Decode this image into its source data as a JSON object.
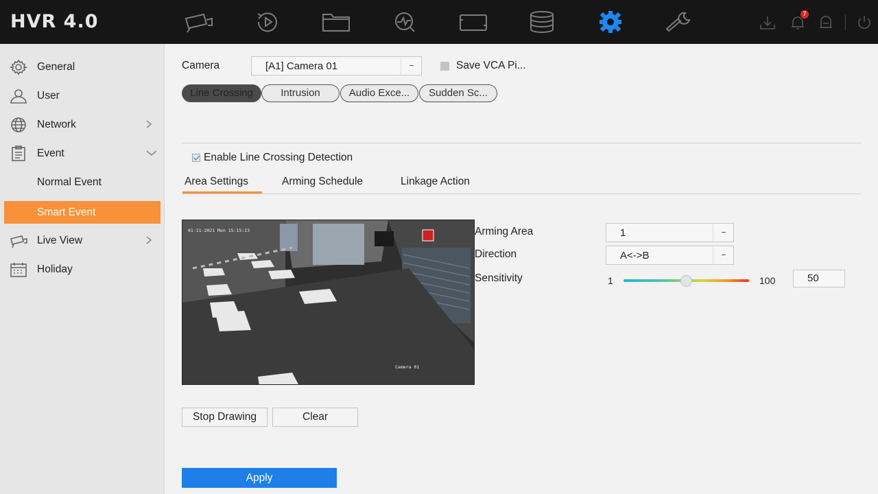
{
  "app": {
    "title": "HVR 4.0"
  },
  "topnav": {
    "items": [
      {
        "name": "live-view",
        "icon": "camera-icon"
      },
      {
        "name": "playback",
        "icon": "playback-icon"
      },
      {
        "name": "file-management",
        "icon": "folder-icon"
      },
      {
        "name": "smart-analysis",
        "icon": "analysis-icon"
      },
      {
        "name": "camera-management",
        "icon": "camera-frame-icon"
      },
      {
        "name": "storage",
        "icon": "database-icon"
      },
      {
        "name": "configuration",
        "icon": "gear-icon",
        "active": true
      },
      {
        "name": "maintenance",
        "icon": "wrench-icon"
      }
    ],
    "utilities": [
      {
        "icon": "download-icon"
      },
      {
        "icon": "alarm-bell-icon",
        "badge": "7"
      },
      {
        "icon": "user-lock-icon"
      },
      {
        "icon": "power-icon"
      }
    ],
    "accent_color": "#1e88f0"
  },
  "sidebar": {
    "items": [
      {
        "label": "General",
        "icon": "gear-icon"
      },
      {
        "label": "User",
        "icon": "user-icon"
      },
      {
        "label": "Network",
        "icon": "globe-icon"
      },
      {
        "label": "Event",
        "icon": "event-list-icon"
      },
      {
        "label": "Normal Event"
      },
      {
        "label": "Smart Event",
        "active": true
      },
      {
        "label": "Live View",
        "icon": "camera-icon"
      },
      {
        "label": "Holiday",
        "icon": "calendar-icon"
      }
    ],
    "active_color": "#f7913a"
  },
  "main": {
    "camera_label": "Camera",
    "camera_value": "[A1] Camera 01",
    "save_vca_label": "Save VCA Pi...",
    "event_tabs": [
      {
        "label": "Line Crossing",
        "active": true
      },
      {
        "label": "Intrusion"
      },
      {
        "label": "Audio Exce..."
      },
      {
        "label": "Sudden Sc..."
      }
    ],
    "enable_label": "Enable Line Crossing Detection",
    "enable_checked": true,
    "sub_tabs": [
      {
        "label": "Area Settings",
        "active": true
      },
      {
        "label": "Arming Schedule"
      },
      {
        "label": "Linkage Action"
      }
    ],
    "preview": {
      "timestamp": "01-11-2021 Mon 15:15:23",
      "camera_name": "Camera 01"
    },
    "arming_area_label": "Arming Area",
    "arming_area_value": "1",
    "direction_label": "Direction",
    "direction_value": "A<->B",
    "sensitivity_label": "Sensitivity",
    "sensitivity_min": "1",
    "sensitivity_max": "100",
    "sensitivity_value": "50",
    "stop_drawing_label": "Stop Drawing",
    "clear_label": "Clear",
    "apply_label": "Apply",
    "apply_color": "#1e7fe8"
  }
}
